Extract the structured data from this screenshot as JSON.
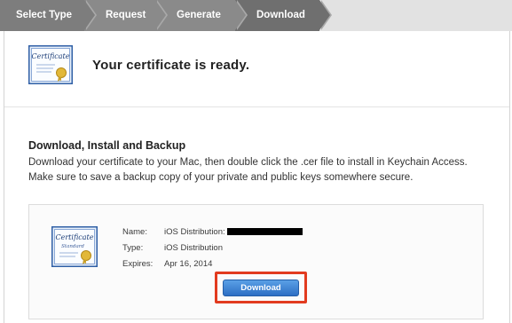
{
  "steps": [
    {
      "label": "Select Type"
    },
    {
      "label": "Request"
    },
    {
      "label": "Generate"
    },
    {
      "label": "Download"
    }
  ],
  "hero": {
    "title": "Your certificate is ready.",
    "icon": "certificate-icon",
    "icon_text": "Certificate"
  },
  "section": {
    "title": "Download, Install and Backup",
    "description": "Download your certificate to your Mac, then double click the .cer file to install in Keychain Access. Make sure to save a backup copy of your private and public keys somewhere secure."
  },
  "certificate": {
    "icon": "certificate-icon",
    "icon_text": "Certificate",
    "icon_subtext": "Standard",
    "name_label": "Name:",
    "name_value": "iOS Distribution:",
    "type_label": "Type:",
    "type_value": "iOS Distribution",
    "expires_label": "Expires:",
    "expires_value": "Apr 16, 2014",
    "download_label": "Download"
  },
  "colors": {
    "highlight": "#e23b1f",
    "button": "#2d6fc4",
    "step_bar": "#8a8a8a"
  }
}
